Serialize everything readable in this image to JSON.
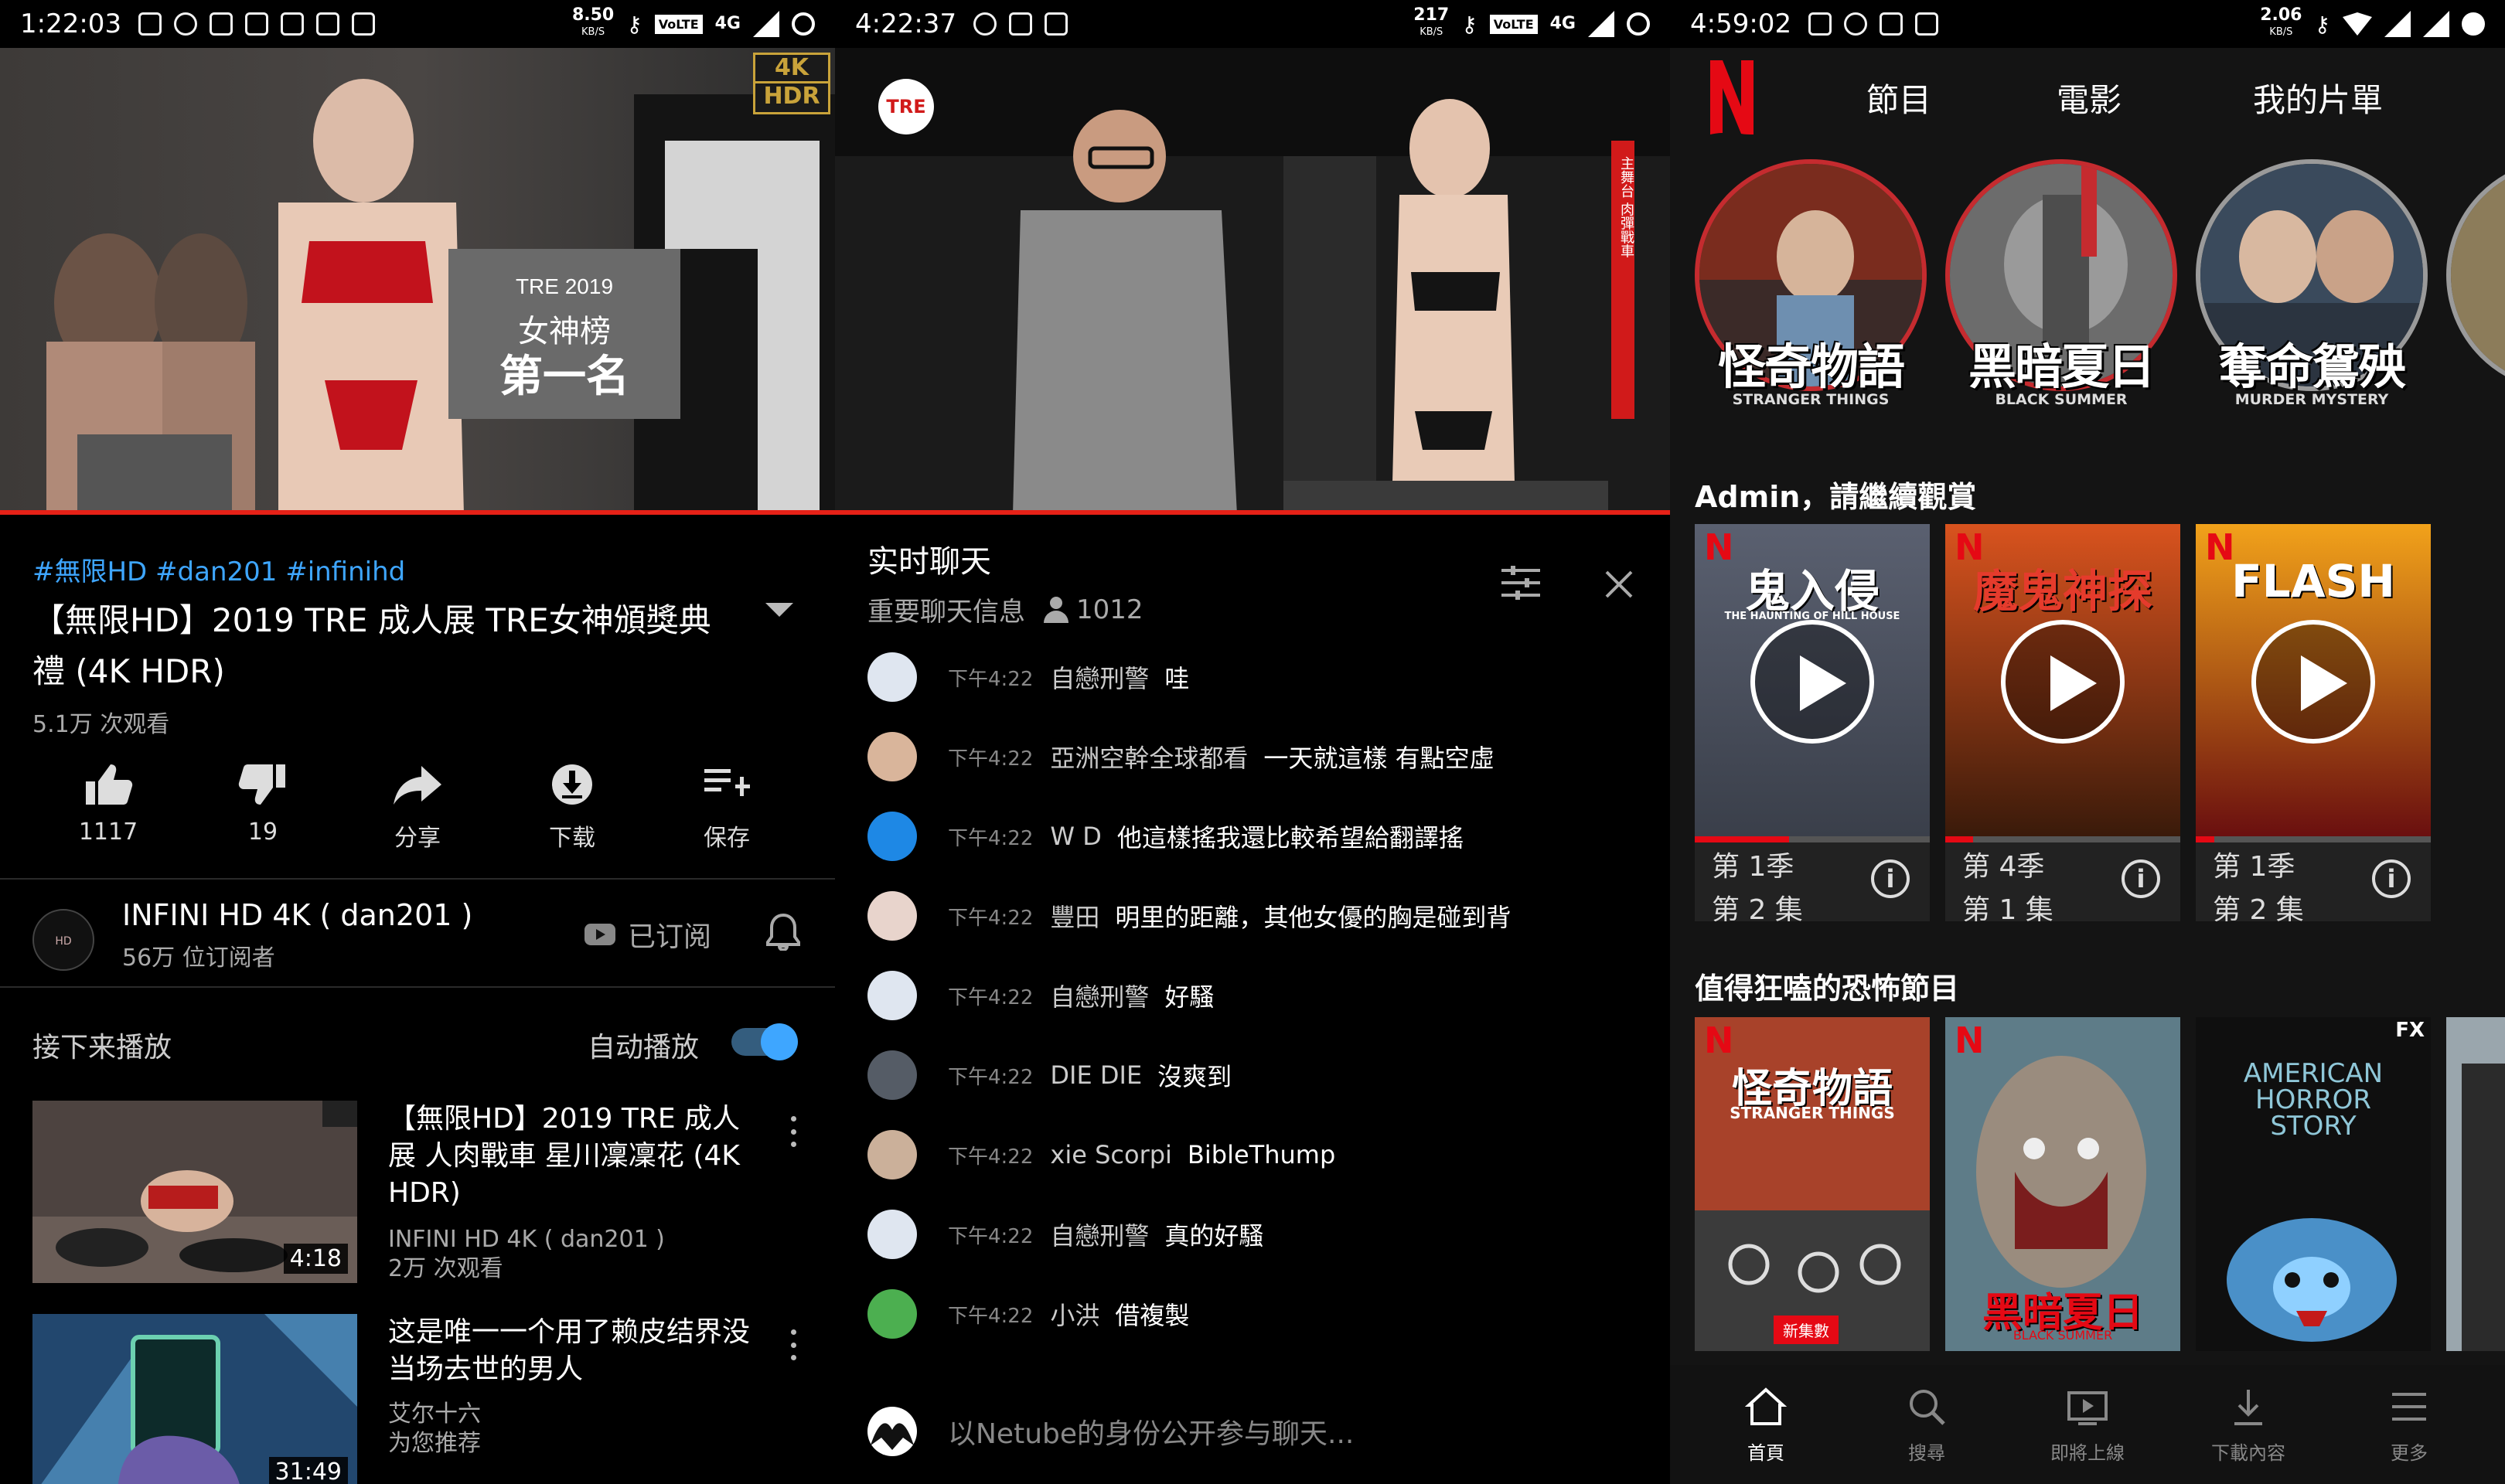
{
  "colors": {
    "yt_red": "#e62117",
    "nf_red": "#e50914",
    "link_blue": "#3ea6ff"
  },
  "panel1": {
    "status": {
      "time": "1:22:03",
      "speed": "8.50",
      "speed_unit": "KB/S",
      "volte": "VoLTE",
      "net": "4G"
    },
    "video_badge": {
      "top": "4K",
      "bottom": "HDR"
    },
    "scene_sign": {
      "line1": "女神榜",
      "line2": "第一名",
      "year": "2019"
    },
    "progress": 1.0,
    "tags": "#無限HD #dan201 #infinihd",
    "title": "【無限HD】2019 TRE 成人展 TRE女神頒獎典禮 (4K HDR)",
    "views": "5.1万 次观看",
    "actions": [
      {
        "icon": "thumbs-up-icon",
        "label": "1117"
      },
      {
        "icon": "thumbs-down-icon",
        "label": "19"
      },
      {
        "icon": "share-icon",
        "label": "分享"
      },
      {
        "icon": "download-icon",
        "label": "下载"
      },
      {
        "icon": "save-playlist-icon",
        "label": "保存"
      }
    ],
    "channel": {
      "name": "INFINI HD 4K ( dan201 )",
      "subs": "56万 位订阅者",
      "logo_text": "HD",
      "subscribed_label": "已订阅"
    },
    "up_next": "接下来播放",
    "autoplay": "自动播放",
    "autoplay_on": true,
    "recs": [
      {
        "title": "【無限HD】2019 TRE 成人展 人肉戰車 星川凜凜花 (4K HDR)",
        "channel": "INFINI HD 4K ( dan201 )",
        "meta": "2万 次观看",
        "duration": "4:18"
      },
      {
        "title": "这是唯一一个用了赖皮结界没当场去世的男人",
        "channel": "艾尔十六",
        "meta": "为您推荐",
        "duration": "31:49"
      }
    ]
  },
  "panel2": {
    "status": {
      "time": "4:22:37",
      "speed": "217",
      "speed_unit": "KB/S",
      "volte": "VoLTE",
      "net": "4G"
    },
    "progress": 1.0,
    "logo_text": "TRE",
    "banner_text": "主舞台 肉彈戰車",
    "chat_title": "实时聊天",
    "chat_filter": "重要聊天信息",
    "viewer_count": "1012",
    "messages": [
      {
        "time": "下午4:22",
        "author": "自戀刑警",
        "text": "哇",
        "avatar": "#dfe6f0"
      },
      {
        "time": "下午4:22",
        "author": "亞洲空幹全球都看",
        "text": "一天就這樣 有點空虛",
        "avatar": "#d9b59b"
      },
      {
        "time": "下午4:22",
        "author": "W D",
        "text": "他這樣搖我還比較希望給翻譯搖",
        "avatar": "#1e88e5"
      },
      {
        "time": "下午4:22",
        "author": "豐田",
        "text": "明里的距離，其他女優的胸是碰到背",
        "avatar": "#e8d4cc"
      },
      {
        "time": "下午4:22",
        "author": "自戀刑警",
        "text": "好騷",
        "avatar": "#dfe6f0"
      },
      {
        "time": "下午4:22",
        "author": "DIE DIE",
        "text": "沒爽到",
        "avatar": "#555c66"
      },
      {
        "time": "下午4:22",
        "author": "xie Scorpi",
        "text": "BibleThump",
        "avatar": "#cbb09a"
      },
      {
        "time": "下午4:22",
        "author": "自戀刑警",
        "text": "真的好騷",
        "avatar": "#dfe6f0"
      },
      {
        "time": "下午4:22",
        "author": "小洪",
        "text": "借複製",
        "avatar": "#4caf50"
      }
    ],
    "input_placeholder": "以Netube的身份公开参与聊天..."
  },
  "panel3": {
    "status": {
      "time": "4:59:02",
      "speed": "2.06",
      "speed_unit": "KB/S"
    },
    "logo": "N",
    "nav": [
      "節目",
      "電影",
      "我的片單"
    ],
    "previews": [
      {
        "title": "怪奇物語",
        "subtitle": "STRANGER THINGS",
        "ring": "red"
      },
      {
        "title": "黑暗夏日",
        "subtitle": "BLACK SUMMER",
        "ring": "red"
      },
      {
        "title": "奪命鴛殃",
        "subtitle": "MURDER MYSTERY",
        "ring": "gray"
      }
    ],
    "continue_title": "Admin，請繼續觀賞",
    "continue": [
      {
        "poster_title": "鬼入侵",
        "poster_sub": "THE HAUNTING OF HILL HOUSE",
        "line1": "第 1季",
        "line2": "第 2 集",
        "progress": 0.4
      },
      {
        "poster_title": "魔鬼神探",
        "poster_sub": "",
        "line1": "第 4季",
        "line2": "第 1 集",
        "progress": 0.12
      },
      {
        "poster_title": "FLASH",
        "poster_sub": "",
        "line1": "第 1季",
        "line2": "第 2 集",
        "progress": 0.08
      }
    ],
    "horror_title": "值得狂嗑的恐怖節目",
    "horror": [
      {
        "title": "怪奇物語",
        "sub": "STRANGER THINGS",
        "badge": "新集數"
      },
      {
        "title": "黑暗夏日",
        "sub": "BLACK SUMMER",
        "badge": ""
      },
      {
        "title": "AMERICAN HORROR STORY",
        "sub": "",
        "badge": "FX"
      }
    ],
    "bottom_nav": [
      {
        "icon": "home-icon",
        "label": "首頁",
        "active": true
      },
      {
        "icon": "search-icon",
        "label": "搜尋",
        "active": false
      },
      {
        "icon": "coming-soon-icon",
        "label": "即將上線",
        "active": false
      },
      {
        "icon": "download-icon",
        "label": "下載內容",
        "active": false
      },
      {
        "icon": "menu-icon",
        "label": "更多",
        "active": false
      }
    ]
  }
}
